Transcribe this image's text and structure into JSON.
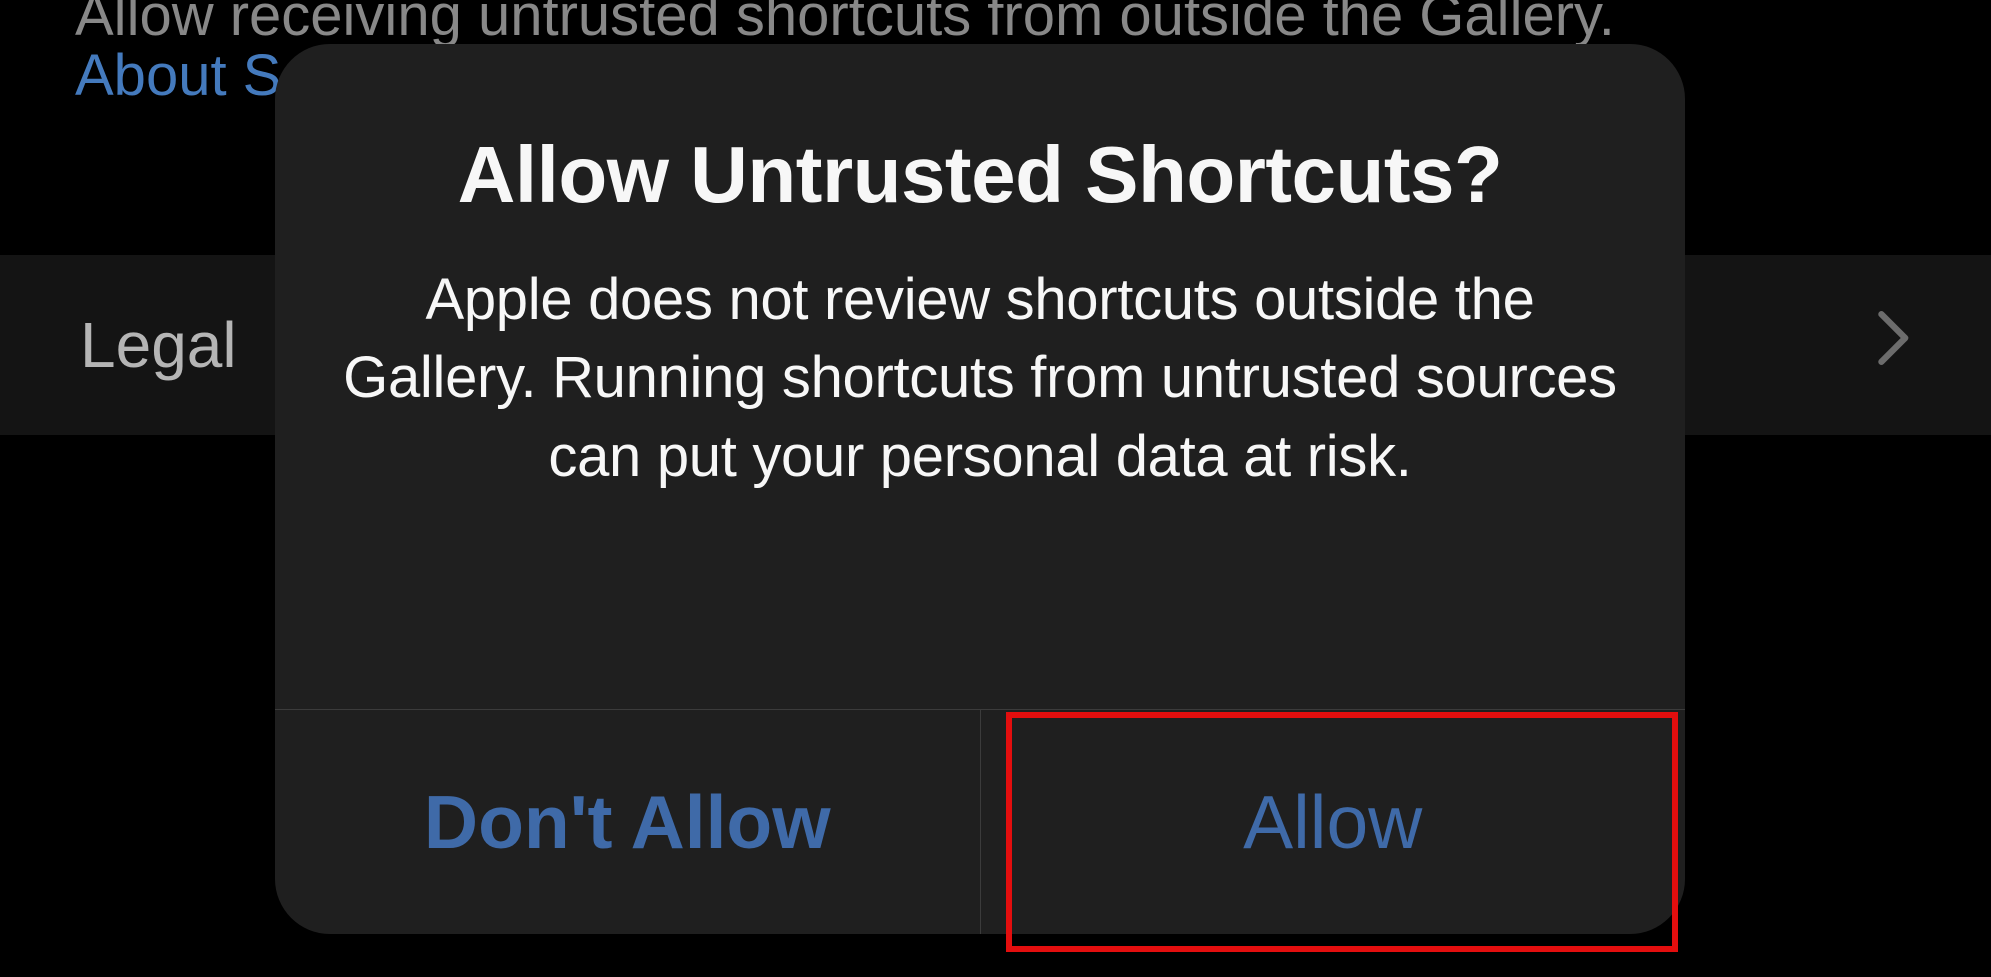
{
  "background": {
    "description_text": "Allow receiving untrusted shortcuts from outside the Gallery.",
    "about_link_prefix": "About S",
    "legal_row_label": "Legal"
  },
  "dialog": {
    "title": "Allow Untrusted Shortcuts?",
    "body": "Apple does not review shortcuts outside the Gallery. Running shortcuts from untrusted sources can put your personal data at risk.",
    "buttons": {
      "dont_allow": "Don't Allow",
      "allow": "Allow"
    }
  },
  "colors": {
    "accent": "#3f6aa8",
    "highlight": "#e30e0e",
    "dialog_bg": "#1f1f1f",
    "text_primary": "#f7f7f7"
  }
}
